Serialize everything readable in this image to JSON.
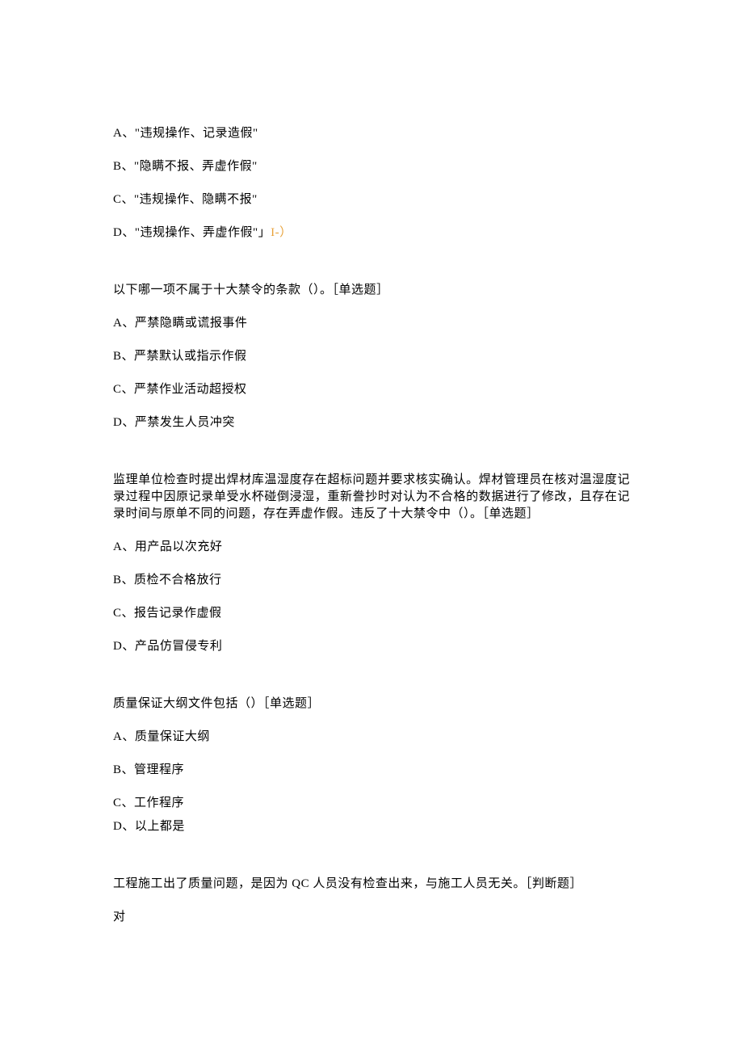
{
  "q1": {
    "optA": "A、\"违规操作、记录造假\"",
    "optB": "B、\"隐瞒不报、弄虚作假\"",
    "optC": "C、\"违规操作、隐瞒不报\"",
    "optD_prefix": "D、\"违规操作、弄虚作假\"」",
    "optD_mark": "I-）"
  },
  "q2": {
    "stem": "以下哪一项不属于十大禁令的条款（）。［单选题］",
    "optA": "A、严禁隐瞒或谎报事件",
    "optB": "B、严禁默认或指示作假",
    "optC": "C、严禁作业活动超授权",
    "optD": "D、严禁发生人员冲突"
  },
  "q3": {
    "stem": "监理单位检查时提出焊材库温湿度存在超标问题并要求核实确认。焊材管理员在核对温湿度记录过程中因原记录单受水杯碰倒浸湿，重新誊抄时对认为不合格的数据进行了修改，且存在记录时间与原单不同的问题，存在弄虚作假。违反了十大禁令中（）。［单选题］",
    "optA": "A、用产品以次充好",
    "optB": "B、质检不合格放行",
    "optC": "C、报告记录作虚假",
    "optD": "D、产品仿冒侵专利"
  },
  "q4": {
    "stem": "质量保证大纲文件包括（）［单选题］",
    "optA": "A、质量保证大纲",
    "optB": "B、管理程序",
    "optC": "C、工作程序",
    "optD": "D、以上都是"
  },
  "q5": {
    "stem": "工程施工出了质量问题，是因为 QC 人员没有检查出来，与施工人员无关。［判断题］",
    "ans": "对"
  }
}
